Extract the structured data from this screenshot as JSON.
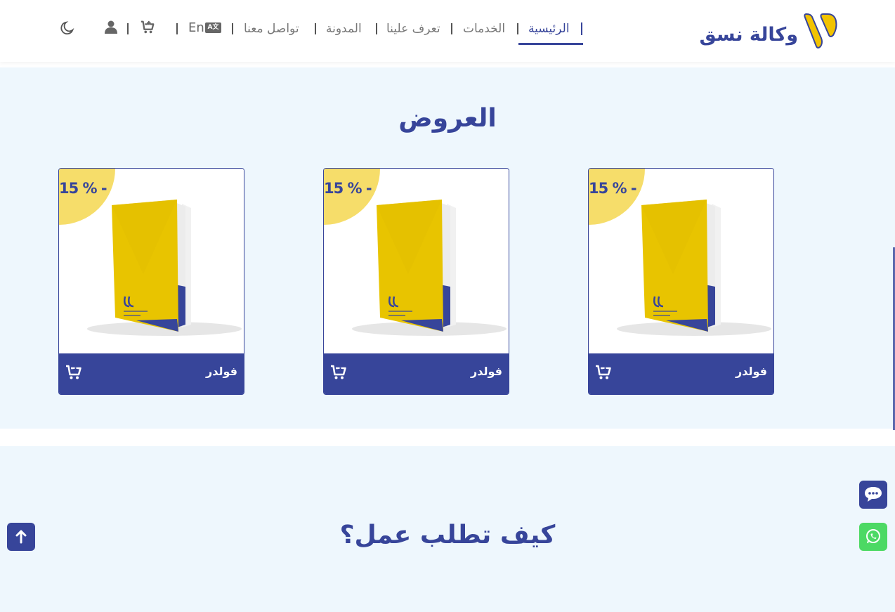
{
  "header": {
    "logo_text": "وكالة نسق",
    "nav": {
      "home": "الرئيسية",
      "services": "الخدمات",
      "about": "تعرف علينا",
      "blog": "المدونة",
      "contact": "تواصل معنا"
    },
    "lang_label": "En",
    "lang_icon_text": "A文",
    "icons": [
      "language-icon",
      "cart-icon",
      "user-icon",
      "moon-icon"
    ]
  },
  "offers": {
    "title": "العروض",
    "cards": [
      {
        "name": "فولدر",
        "discount": "15 % -"
      },
      {
        "name": "فولدر",
        "discount": "15 % -"
      },
      {
        "name": "فولدر",
        "discount": "15 % -"
      }
    ]
  },
  "how": {
    "title": "كيف تطلب عمل؟"
  },
  "floating": {
    "chat_icon": "chat-icon",
    "whatsapp_icon": "whatsapp-icon",
    "scroll_top_icon": "arrow-up-icon"
  },
  "colors": {
    "primary": "#37459a",
    "accent_yellow": "#f6dd6a",
    "section_bg": "#eef7fd",
    "whatsapp": "#4cd964"
  }
}
